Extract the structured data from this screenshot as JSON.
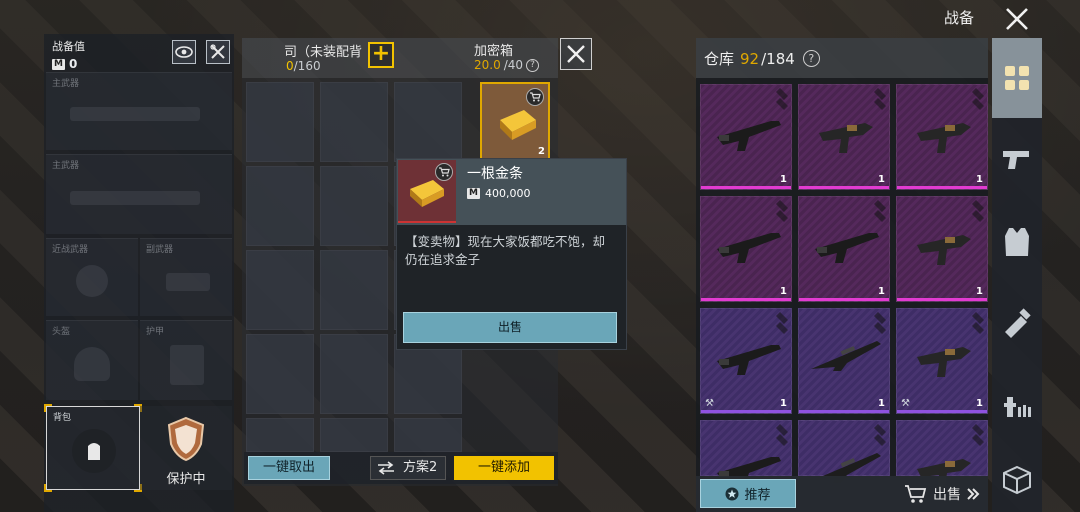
{
  "header": {
    "title": "战备"
  },
  "loadout": {
    "title": "战备值",
    "value": "0",
    "currency_badge": "M",
    "slots": [
      {
        "label": "主武器"
      },
      {
        "label": "主武器"
      },
      {
        "label": "近战武器"
      },
      {
        "label": "副武器"
      },
      {
        "label": "头盔"
      },
      {
        "label": "护甲"
      }
    ],
    "backpack_label": "背包",
    "protect_label": "保护中"
  },
  "pack": {
    "title": "司（未装配背",
    "capacity_used": "0",
    "capacity_total": "/160",
    "encrypted_title": "加密箱",
    "encrypted_used": "20.0",
    "encrypted_total": "/40",
    "gold_count": "2",
    "take_all_label": "一键取出",
    "plan_label": "方案2",
    "add_all_label": "一键添加"
  },
  "tooltip": {
    "name": "一根金条",
    "price": "400,000",
    "currency_badge": "M",
    "description": "【变卖物】现在大家饭都吃不饱，却仍在追求金子",
    "sell_label": "出售"
  },
  "warehouse": {
    "title": "仓库",
    "used": "92",
    "total": "/184",
    "items": [
      {
        "rarity": "mag",
        "count": "1",
        "stripe": "#e23bd1",
        "weapon": "rifle"
      },
      {
        "rarity": "mag",
        "count": "1",
        "stripe": "#e23bd1",
        "weapon": "smg"
      },
      {
        "rarity": "mag",
        "count": "1",
        "stripe": "#e23bd1",
        "weapon": "smg"
      },
      {
        "rarity": "mag",
        "count": "1",
        "stripe": "#e23bd1",
        "weapon": "rifle"
      },
      {
        "rarity": "mag",
        "count": "1",
        "stripe": "#e23bd1",
        "weapon": "rifle"
      },
      {
        "rarity": "mag",
        "count": "1",
        "stripe": "#e23bd1",
        "weapon": "smg"
      },
      {
        "rarity": "pur",
        "count": "1",
        "stripe": "#8f52e0",
        "weapon": "rifle",
        "wrench": true
      },
      {
        "rarity": "pur",
        "count": "1",
        "stripe": "#8f52e0",
        "weapon": "sniper"
      },
      {
        "rarity": "pur",
        "count": "1",
        "stripe": "#8f52e0",
        "weapon": "smg",
        "wrench": true
      },
      {
        "rarity": "pur",
        "count": "",
        "stripe": "",
        "weapon": "rifle"
      },
      {
        "rarity": "pur",
        "count": "",
        "stripe": "",
        "weapon": "sniper"
      },
      {
        "rarity": "pur",
        "count": "",
        "stripe": "",
        "weapon": "smg"
      }
    ],
    "recommend_label": "推荐",
    "sell_label": "出售"
  },
  "side_tabs": [
    {
      "icon": "grid-icon",
      "active": true
    },
    {
      "icon": "pistol-icon"
    },
    {
      "icon": "armor-vest-icon"
    },
    {
      "icon": "attachment-icon"
    },
    {
      "icon": "medical-icon"
    },
    {
      "icon": "box-icon"
    }
  ],
  "colors": {
    "accent_yellow": "#f2c200",
    "teal_button": "#6aa6b8",
    "rarity_magenta": "#e23bd1",
    "rarity_purple": "#8f52e0"
  }
}
